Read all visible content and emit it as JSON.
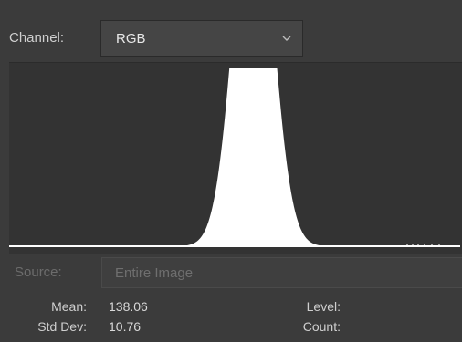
{
  "channel": {
    "label": "Channel:",
    "selected": "RGB"
  },
  "icons": {
    "dropdown": "chevron-down-icon"
  },
  "histogram": {
    "mode": "RGB",
    "fill_color": "#ffffff",
    "background_color": "#333333",
    "min_level": 0,
    "max_level": 255,
    "distribution_peak_level": 138,
    "distribution_std_dev": 10.76
  },
  "source": {
    "label": "Source:",
    "value": "Entire Image"
  },
  "stats": {
    "mean_label": "Mean:",
    "mean_value": "138.06",
    "std_dev_label": "Std Dev:",
    "std_dev_value": "10.76",
    "level_label": "Level:",
    "count_label": "Count:"
  },
  "colors": {
    "panel_bg": "#3b3b3b",
    "text": "#d6d6d6",
    "disabled_text": "#6c6c6c"
  }
}
